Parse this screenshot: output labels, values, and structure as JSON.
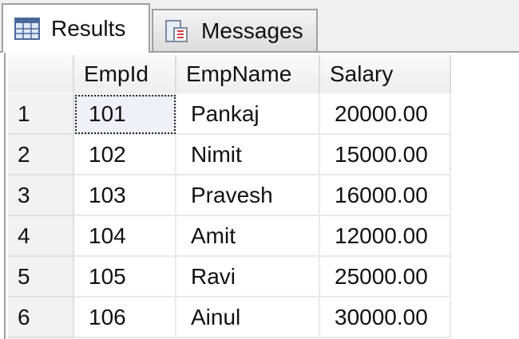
{
  "tabs": [
    {
      "label": "Results",
      "icon": "grid-icon"
    },
    {
      "label": "Messages",
      "icon": "messages-icon"
    }
  ],
  "columns": [
    "EmpId",
    "EmpName",
    "Salary"
  ],
  "rows": [
    {
      "n": "1",
      "id": "101",
      "name": "Pankaj",
      "salary": "20000.00"
    },
    {
      "n": "2",
      "id": "102",
      "name": "Nimit",
      "salary": "15000.00"
    },
    {
      "n": "3",
      "id": "103",
      "name": "Pravesh",
      "salary": "16000.00"
    },
    {
      "n": "4",
      "id": "104",
      "name": "Amit",
      "salary": "12000.00"
    },
    {
      "n": "5",
      "id": "105",
      "name": "Ravi",
      "salary": "25000.00"
    },
    {
      "n": "6",
      "id": "106",
      "name": "Ainul",
      "salary": "30000.00"
    }
  ]
}
